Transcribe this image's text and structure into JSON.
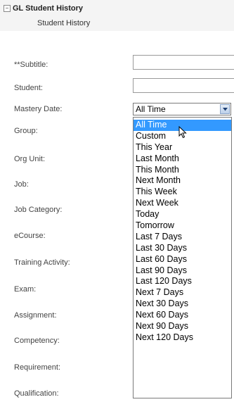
{
  "header": {
    "title": "GL Student History",
    "subtitle": "Student History"
  },
  "form": {
    "subtitle_label": "**Subtitle:",
    "student_label": "Student:",
    "mastery_date_label": "Mastery Date:",
    "group_label": "Group:",
    "org_unit_label": "Org Unit:",
    "job_label": "Job:",
    "job_category_label": "Job Category:",
    "ecourse_label": "eCourse:",
    "training_activity_label": "Training Activity:",
    "exam_label": "Exam:",
    "assignment_label": "Assignment:",
    "competency_label": "Competency:",
    "requirement_label": "Requirement:",
    "qualification_label": "Qualification:"
  },
  "mastery_date": {
    "selected": "All Time",
    "options": [
      "All Time",
      "Custom",
      "This Year",
      "Last Month",
      "This Month",
      "Next Month",
      "This Week",
      "Next Week",
      "Today",
      "Tomorrow",
      "Last 7 Days",
      "Last 30 Days",
      "Last 60 Days",
      "Last 90 Days",
      "Last 120 Days",
      "Next 7 Days",
      "Next 30 Days",
      "Next 60 Days",
      "Next 90 Days",
      "Next 120 Days"
    ],
    "highlighted_index": 0
  },
  "icons": {
    "expander": "collapse-toggle-icon",
    "dropdown_arrow": "chevron-down-icon",
    "cursor": "mouse-pointer-icon"
  },
  "colors": {
    "highlight": "#3399ff",
    "header_bg": "#f4f4f4"
  }
}
